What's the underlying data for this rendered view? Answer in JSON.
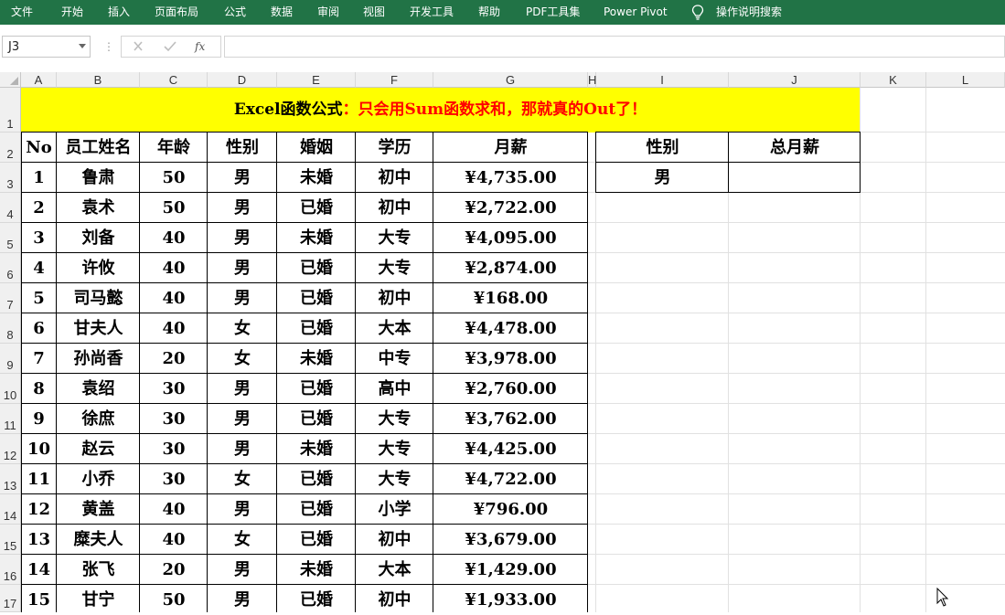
{
  "ribbon": {
    "tabs": [
      "文件",
      "开始",
      "插入",
      "页面布局",
      "公式",
      "数据",
      "审阅",
      "视图",
      "开发工具",
      "帮助",
      "PDF工具集",
      "Power Pivot"
    ],
    "tell_me": "操作说明搜索"
  },
  "formula_bar": {
    "name_box": "J3",
    "fx_label": "fx",
    "formula": ""
  },
  "columns": [
    "A",
    "B",
    "C",
    "D",
    "E",
    "F",
    "G",
    "H",
    "I",
    "J",
    "K",
    "L"
  ],
  "rows": [
    "1",
    "2",
    "3",
    "4",
    "5",
    "6",
    "7",
    "8",
    "9",
    "10",
    "11",
    "12",
    "13",
    "14",
    "15",
    "16",
    "17"
  ],
  "title": {
    "part1": "Excel函数公式",
    "part2": "：只会用Sum函数求和，那就真的Out了！"
  },
  "colors": {
    "ribbon_bg": "#217346",
    "title_bg": "#ffff00",
    "title_accent": "#ff0000"
  },
  "table": {
    "headers": [
      "No",
      "员工姓名",
      "年龄",
      "性别",
      "婚姻",
      "学历",
      "月薪"
    ],
    "rows": [
      [
        "1",
        "鲁肃",
        "50",
        "男",
        "未婚",
        "初中",
        "¥4,735.00"
      ],
      [
        "2",
        "袁术",
        "50",
        "男",
        "已婚",
        "初中",
        "¥2,722.00"
      ],
      [
        "3",
        "刘备",
        "40",
        "男",
        "未婚",
        "大专",
        "¥4,095.00"
      ],
      [
        "4",
        "许攸",
        "40",
        "男",
        "已婚",
        "大专",
        "¥2,874.00"
      ],
      [
        "5",
        "司马懿",
        "40",
        "男",
        "已婚",
        "初中",
        "¥168.00"
      ],
      [
        "6",
        "甘夫人",
        "40",
        "女",
        "已婚",
        "大本",
        "¥4,478.00"
      ],
      [
        "7",
        "孙尚香",
        "20",
        "女",
        "未婚",
        "中专",
        "¥3,978.00"
      ],
      [
        "8",
        "袁绍",
        "30",
        "男",
        "已婚",
        "高中",
        "¥2,760.00"
      ],
      [
        "9",
        "徐庶",
        "30",
        "男",
        "已婚",
        "大专",
        "¥3,762.00"
      ],
      [
        "10",
        "赵云",
        "30",
        "男",
        "未婚",
        "大专",
        "¥4,425.00"
      ],
      [
        "11",
        "小乔",
        "30",
        "女",
        "已婚",
        "大专",
        "¥4,722.00"
      ],
      [
        "12",
        "黄盖",
        "40",
        "男",
        "已婚",
        "小学",
        "¥796.00"
      ],
      [
        "13",
        "糜夫人",
        "40",
        "女",
        "已婚",
        "初中",
        "¥3,679.00"
      ],
      [
        "14",
        "张飞",
        "20",
        "男",
        "未婚",
        "大本",
        "¥1,429.00"
      ],
      [
        "15",
        "甘宁",
        "50",
        "男",
        "已婚",
        "初中",
        "¥1,933.00"
      ]
    ]
  },
  "summary": {
    "headers": [
      "性别",
      "总月薪"
    ],
    "row": [
      "男",
      ""
    ]
  }
}
